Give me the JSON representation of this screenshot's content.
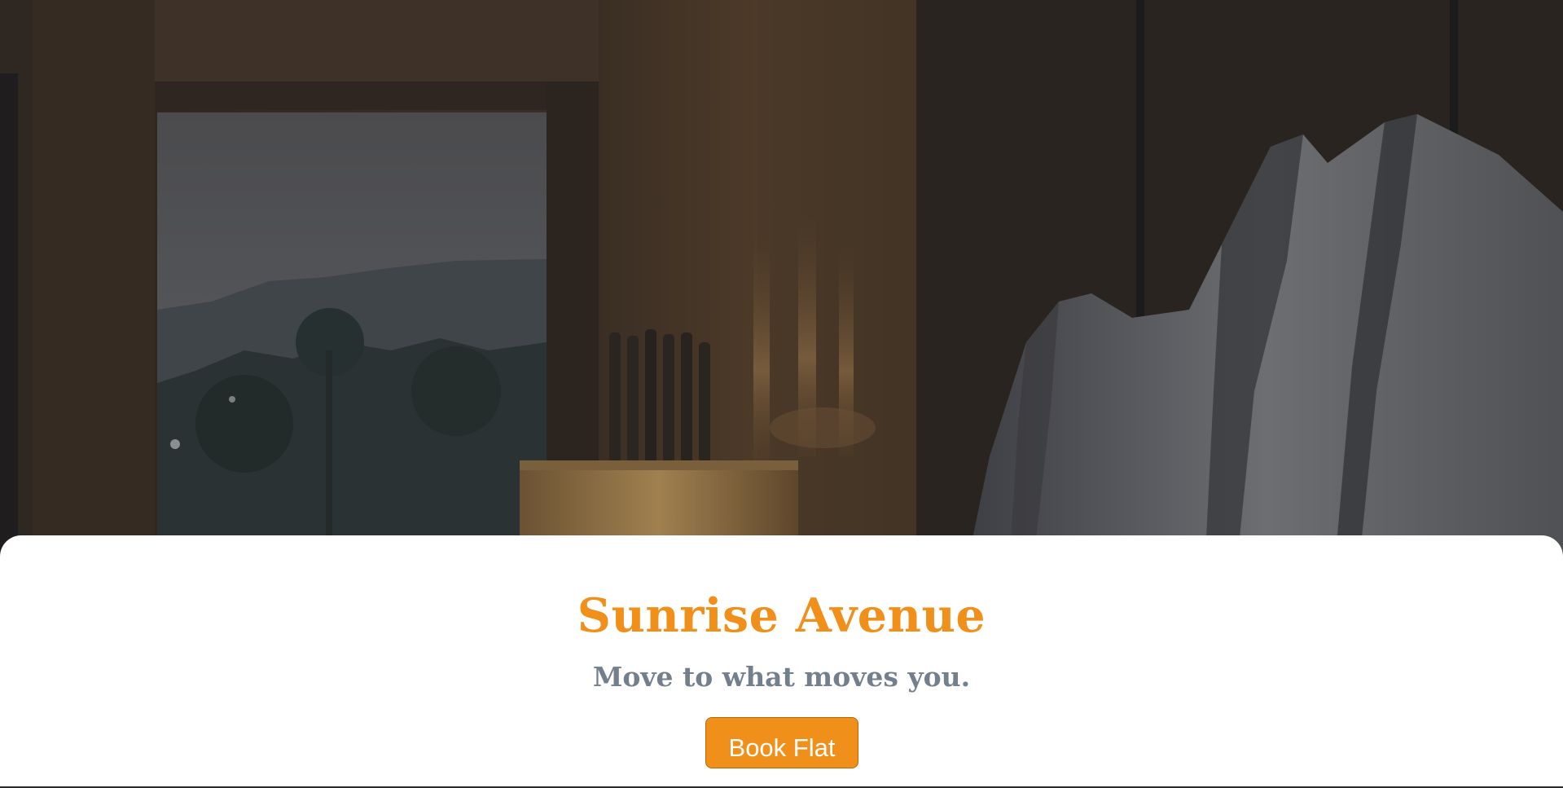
{
  "hero": {
    "image_icon": "hero-interior-photo"
  },
  "card": {
    "title": "Sunrise Avenue",
    "subtitle": "Move to what moves you.",
    "book_button_label": "Book Flat"
  },
  "colors": {
    "accent": "#f0901a",
    "subtitle": "#747f8e",
    "card_background": "#ffffff"
  }
}
